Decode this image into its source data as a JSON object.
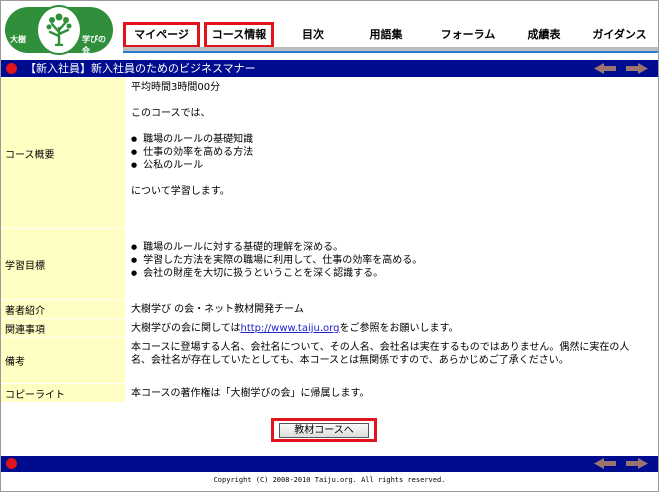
{
  "logo": {
    "left_text": "大樹",
    "right_text": "学びの会"
  },
  "nav": [
    {
      "label": "マイページ",
      "boxed": true
    },
    {
      "label": "コース情報",
      "boxed": true
    },
    {
      "label": "目次",
      "boxed": false
    },
    {
      "label": "用語集",
      "boxed": false
    },
    {
      "label": "フォーラム",
      "boxed": false
    },
    {
      "label": "成績表",
      "boxed": false
    },
    {
      "label": "ガイダンス",
      "boxed": false
    }
  ],
  "title": "【新入社員】新入社員のためのビジネスマナー",
  "colors": {
    "bar": "#000c8f",
    "accent": "#e0141a",
    "label_bg": "#ffffc4",
    "logo_green": "#2f8f3a"
  },
  "rows": {
    "overview": {
      "label": "コース概要",
      "time": "平均時間3時間00分",
      "intro": "このコースでは、",
      "items": [
        "職場のルールの基礎知識",
        "仕事の効率を高める方法",
        "公私のルール"
      ],
      "outro": "について学習します。"
    },
    "goals": {
      "label": "学習目標",
      "items": [
        "職場のルールに対する基礎的理解を深める。",
        "学習した方法を実際の職場に利用して、仕事の効率を高める。",
        "会社の財産を大切に扱うということを深く認識する。"
      ]
    },
    "author": {
      "label": "著者紹介",
      "value": "大樹学び の会・ネット教材開発チーム"
    },
    "related": {
      "label": "関連事項",
      "prefix": "大樹学びの会に関しては",
      "link": "http://www.taiju.org",
      "suffix": "をご参照をお願いします。"
    },
    "notes": {
      "label": "備考",
      "value": "本コースに登場する人名、会社名について、その人名、会社名は実在するものではありません。偶然に実在の人名、会社名が存在していたとしても、本コースとは無関係ですので、あらかじめご了承ください。"
    },
    "copyright": {
      "label": "コピーライト",
      "value": "本コースの著作権は「大樹学びの会」に帰属します。"
    }
  },
  "button": {
    "label": "教材コースへ"
  },
  "footer": {
    "copyright": "Copyright (C) 2008-2010 Taiju.org. All rights reserved."
  }
}
